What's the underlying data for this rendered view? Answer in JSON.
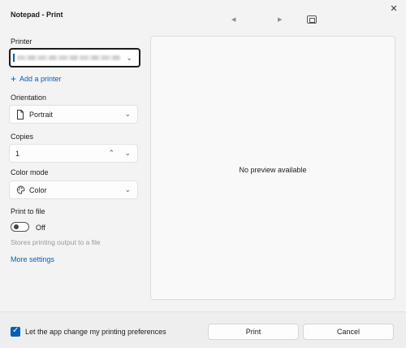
{
  "window": {
    "title": "Notepad - Print",
    "close_glyph": "✕"
  },
  "preview_nav": {
    "prev_glyph": "◀",
    "next_glyph": "▶",
    "fit_icon": "fit-to-window-icon"
  },
  "printer": {
    "label": "Printer",
    "value": "",
    "add_label": "Add a printer",
    "add_glyph": "+"
  },
  "orientation": {
    "label": "Orientation",
    "value": "Portrait",
    "icon": "page-portrait-icon"
  },
  "copies": {
    "label": "Copies",
    "value": "1"
  },
  "color_mode": {
    "label": "Color mode",
    "value": "Color",
    "icon": "palette-icon"
  },
  "print_to_file": {
    "label": "Print to file",
    "state": "Off",
    "hint": "Stores printing output to a file"
  },
  "more_settings": "More settings",
  "preview": {
    "message": "No preview available"
  },
  "footer": {
    "checkbox_label": "Let the app change my printing preferences",
    "checked": true,
    "print_label": "Print",
    "cancel_label": "Cancel"
  },
  "colors": {
    "accent": "#005fb8",
    "background": "#f3f3f3"
  }
}
